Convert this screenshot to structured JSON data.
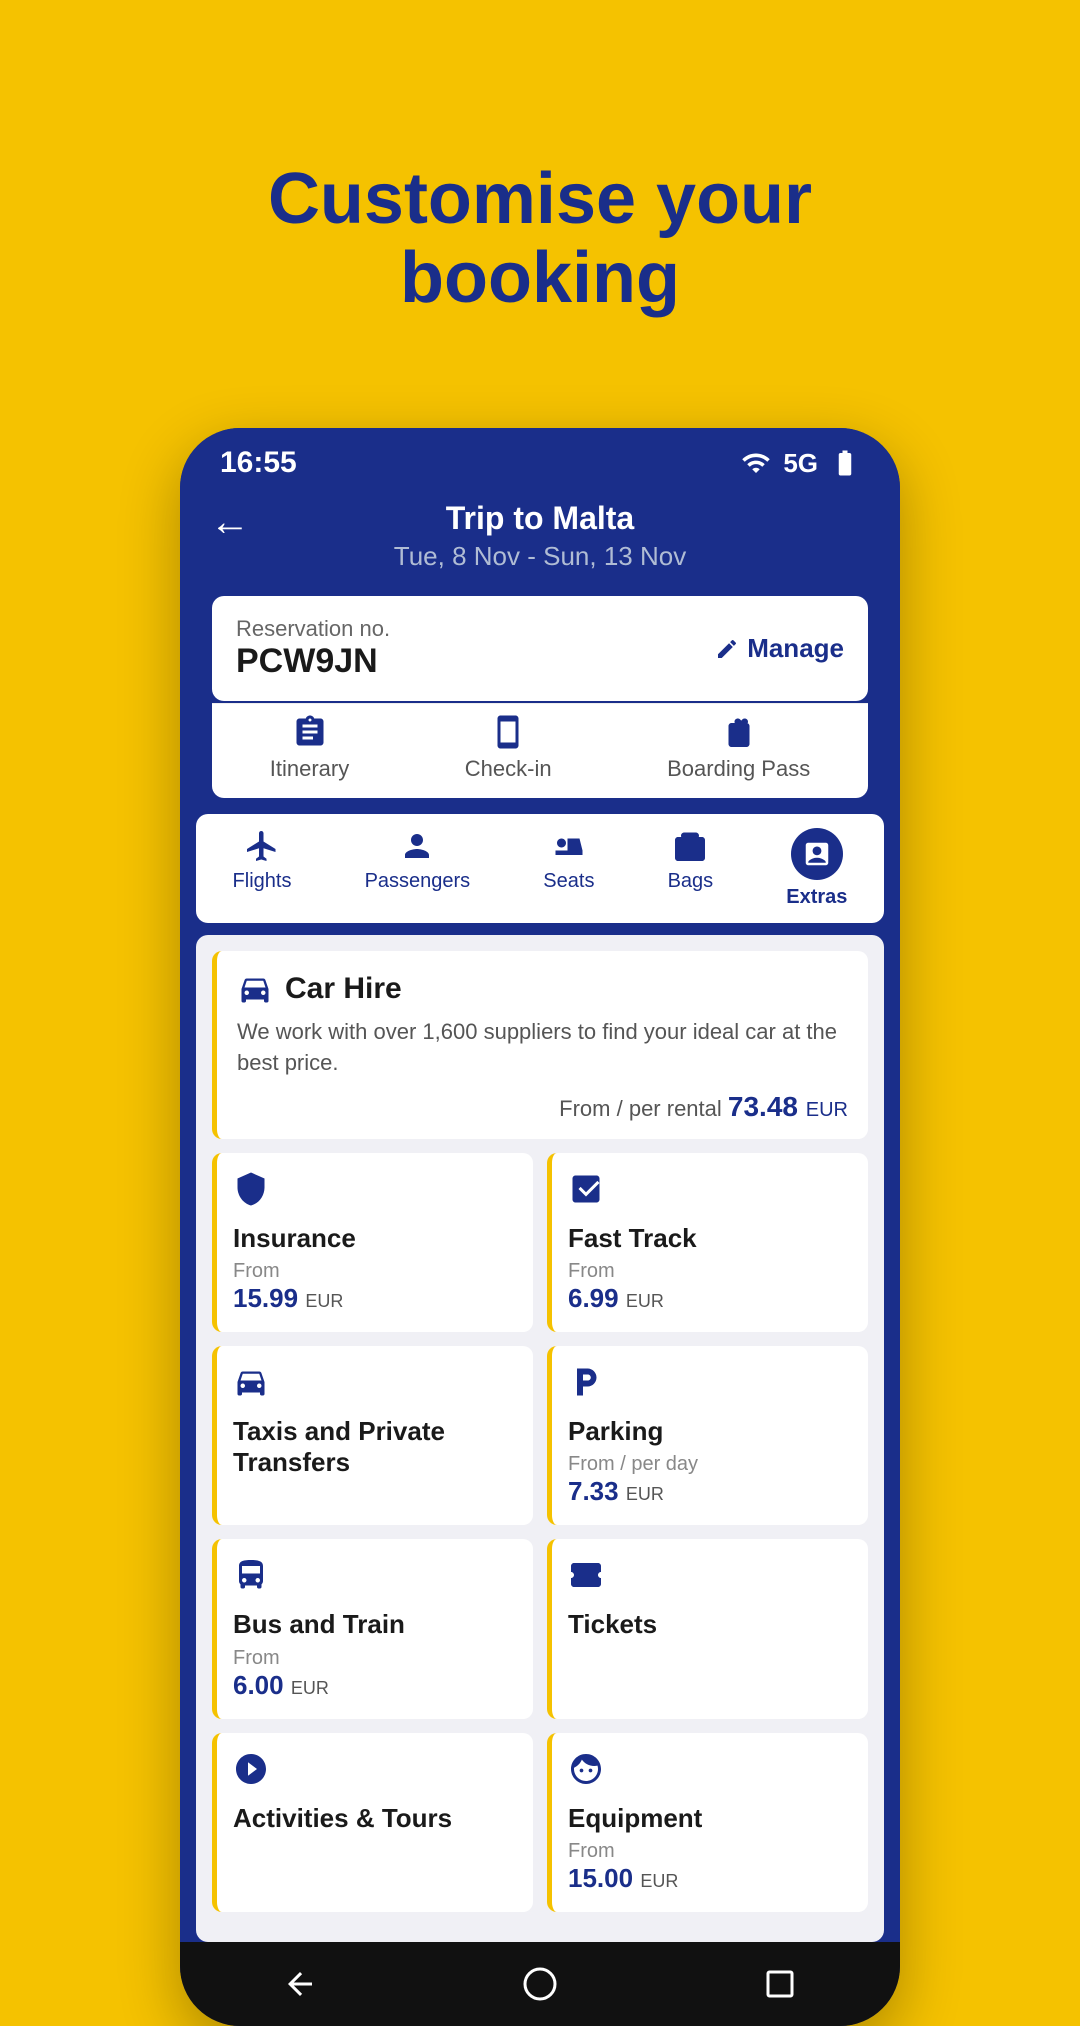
{
  "page": {
    "background_color": "#F5C200",
    "title_line1": "Customise your",
    "title_line2": "booking"
  },
  "status_bar": {
    "time": "16:55",
    "wifi_icon": "wifi",
    "signal_icon": "5G",
    "battery_icon": "battery"
  },
  "header": {
    "trip_title": "Trip to Malta",
    "trip_dates": "Tue, 8 Nov - Sun, 13 Nov",
    "back_label": "←"
  },
  "reservation": {
    "label": "Reservation no.",
    "number": "PCW9JN",
    "manage_label": "Manage"
  },
  "booking_tabs": [
    {
      "id": "itinerary",
      "label": "Itinerary",
      "active": false
    },
    {
      "id": "checkin",
      "label": "Check-in",
      "active": false
    },
    {
      "id": "boarding",
      "label": "Boarding Pass",
      "active": false
    }
  ],
  "nav_items": [
    {
      "id": "flights",
      "label": "Flights",
      "active": false
    },
    {
      "id": "passengers",
      "label": "Passengers",
      "active": false
    },
    {
      "id": "seats",
      "label": "Seats",
      "active": false
    },
    {
      "id": "bags",
      "label": "Bags",
      "active": false
    },
    {
      "id": "extras",
      "label": "Extras",
      "active": true
    }
  ],
  "extras": {
    "car_hire": {
      "title": "Car Hire",
      "description": "We work with over 1,600 suppliers to find your ideal car at the best price.",
      "price_prefix": "From / per rental",
      "price": "73.48",
      "currency": "EUR"
    },
    "grid_items": [
      {
        "id": "insurance",
        "title": "Insurance",
        "from_label": "From",
        "price": "15.99",
        "currency": "EUR",
        "per_day": false
      },
      {
        "id": "fast-track",
        "title": "Fast Track",
        "from_label": "From",
        "price": "6.99",
        "currency": "EUR",
        "per_day": false
      },
      {
        "id": "taxis",
        "title": "Taxis and Private Transfers",
        "from_label": "",
        "price": "",
        "currency": "",
        "per_day": false
      },
      {
        "id": "parking",
        "title": "Parking",
        "from_label": "From / per day",
        "price": "7.33",
        "currency": "EUR",
        "per_day": true
      },
      {
        "id": "bus-train",
        "title": "Bus and Train",
        "from_label": "From",
        "price": "6.00",
        "currency": "EUR",
        "per_day": false
      },
      {
        "id": "tickets",
        "title": "Tickets",
        "from_label": "",
        "price": "",
        "currency": "",
        "per_day": false
      },
      {
        "id": "activities",
        "title": "Activities & Tours",
        "from_label": "",
        "price": "",
        "currency": "",
        "per_day": false
      },
      {
        "id": "equipment",
        "title": "Equipment",
        "from_label": "From",
        "price": "15.00",
        "currency": "EUR",
        "per_day": false
      }
    ]
  }
}
